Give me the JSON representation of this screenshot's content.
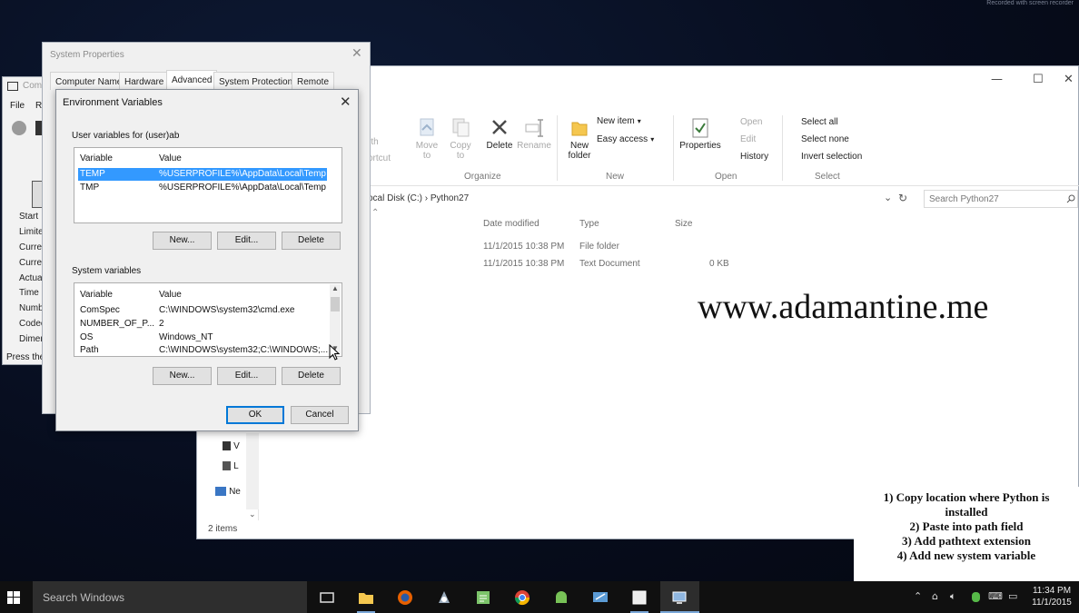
{
  "watermark_top": "Recorded with screen recorder",
  "explorer": {
    "controls": {
      "minimize": "—",
      "maximize": "☐",
      "close": "✕"
    },
    "ribbon": {
      "clipboard_partial": [
        "rth",
        "ortcut"
      ],
      "move_to": "Move to",
      "copy_to": "Copy to",
      "delete": "Delete",
      "rename": "Rename",
      "new_folder": "New folder",
      "new_item": "New item",
      "easy_access": "Easy access",
      "properties": "Properties",
      "open": "Open",
      "edit": "Edit",
      "history": "History",
      "select_all": "Select all",
      "select_none": "Select none",
      "invert_selection": "Invert selection",
      "groups": {
        "organize": "Organize",
        "new": "New",
        "open": "Open",
        "select": "Select"
      }
    },
    "address": {
      "path": "ocal Disk (C:)  ›  Python27"
    },
    "search_placeholder": "Search Python27",
    "columns": {
      "date": "Date modified",
      "type": "Type",
      "size": "Size"
    },
    "files": [
      {
        "date": "11/1/2015 10:38 PM",
        "type": "File folder",
        "size": ""
      },
      {
        "date": "11/1/2015 10:38 PM",
        "type": "Text Document",
        "size": "0 KB"
      }
    ],
    "nav_items": [
      "V",
      "L",
      "Ne"
    ],
    "status": "2 items"
  },
  "watermark": "www.adamantine.me",
  "steps": [
    "1) Copy location where Python is",
    "installed",
    "2) Paste into path field",
    "3) Add pathtext extension",
    "4) Add new system variable"
  ],
  "cmd": {
    "title": "Com",
    "menu": [
      "File",
      "R"
    ],
    "items": [
      "Start",
      "Limited",
      "Curren",
      "Curren",
      "Actual",
      "Time E",
      "Numb",
      "Codec",
      "Dimen"
    ],
    "footer": "Press the"
  },
  "system_properties": {
    "title": "System Properties",
    "close": "✕",
    "tabs": [
      "Computer Name",
      "Hardware",
      "Advanced",
      "System Protection",
      "Remote"
    ]
  },
  "env_dialog": {
    "title": "Environment Variables",
    "close": "✕",
    "user_group": "User variables for (user)ab",
    "col_variable": "Variable",
    "col_value": "Value",
    "user_vars": [
      {
        "name": "TEMP",
        "value": "%USERPROFILE%\\AppData\\Local\\Temp",
        "selected": true
      },
      {
        "name": "TMP",
        "value": "%USERPROFILE%\\AppData\\Local\\Temp",
        "selected": false
      }
    ],
    "system_group": "System variables",
    "system_vars": [
      {
        "name": "ComSpec",
        "value": "C:\\WINDOWS\\system32\\cmd.exe"
      },
      {
        "name": "NUMBER_OF_P...",
        "value": "2"
      },
      {
        "name": "OS",
        "value": "Windows_NT"
      },
      {
        "name": "Path",
        "value": "C:\\WINDOWS\\system32;C:\\WINDOWS;..."
      }
    ],
    "buttons": {
      "new": "New...",
      "edit": "Edit...",
      "delete": "Delete",
      "ok": "OK",
      "cancel": "Cancel"
    }
  },
  "taskbar": {
    "search_placeholder": "Search Windows",
    "clock_time": "11:34 PM",
    "clock_date": "11/1/2015"
  }
}
